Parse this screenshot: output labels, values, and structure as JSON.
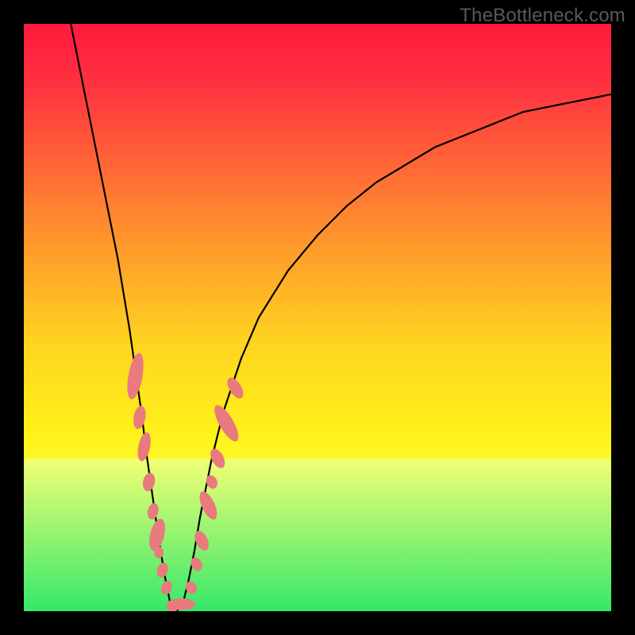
{
  "watermark": "TheBottleneck.com",
  "colors": {
    "frame": "#000000",
    "grad_stops": [
      {
        "offset": 0.0,
        "color": "#ff1a3e"
      },
      {
        "offset": 0.1,
        "color": "#ff3140"
      },
      {
        "offset": 0.25,
        "color": "#ff6a36"
      },
      {
        "offset": 0.4,
        "color": "#ffa12a"
      },
      {
        "offset": 0.55,
        "color": "#ffd61f"
      },
      {
        "offset": 0.7,
        "color": "#fff21a"
      },
      {
        "offset": 0.8,
        "color": "#f7ff3a"
      },
      {
        "offset": 0.88,
        "color": "#d2ff5c"
      },
      {
        "offset": 0.94,
        "color": "#8dff6e"
      },
      {
        "offset": 1.0,
        "color": "#34e86a"
      }
    ],
    "band_top": "#f2ff75",
    "band_bottom": "#35e86a",
    "curve": "#000000",
    "marker_fill": "#e97a7e",
    "marker_stroke": "#d86a70"
  },
  "chart_data": {
    "type": "line",
    "title": "",
    "xlabel": "",
    "ylabel": "",
    "xlim": [
      0,
      100
    ],
    "ylim": [
      0,
      100
    ],
    "note": "Axes are unlabeled; x and y are normalized 0–100 from plot extents. Curve is a V-shaped bottleneck curve with minimum near x≈25, y≈0.",
    "series": [
      {
        "name": "bottleneck-curve",
        "x": [
          8,
          10,
          12,
          14,
          16,
          18,
          20,
          21,
          22,
          23,
          24,
          25,
          26,
          27,
          28,
          29,
          30,
          32,
          34,
          37,
          40,
          45,
          50,
          55,
          60,
          65,
          70,
          75,
          80,
          85,
          90,
          95,
          100
        ],
        "y": [
          100,
          90,
          80,
          70,
          60,
          48,
          34,
          26,
          19,
          12,
          6,
          1,
          0,
          1,
          5,
          10,
          16,
          26,
          34,
          43,
          50,
          58,
          64,
          69,
          73,
          76,
          79,
          81,
          83,
          85,
          86,
          87,
          88
        ]
      }
    ],
    "markers": {
      "name": "highlight-points",
      "comment": "Pink pill/oval markers clustered on both arms near the trough",
      "points": [
        {
          "x": 19.0,
          "y": 40,
          "rx": 1.2,
          "ry": 4.0,
          "rot": 10
        },
        {
          "x": 19.7,
          "y": 33,
          "rx": 1.0,
          "ry": 2.0,
          "rot": 10
        },
        {
          "x": 20.5,
          "y": 28,
          "rx": 1.0,
          "ry": 2.5,
          "rot": 12
        },
        {
          "x": 21.3,
          "y": 22,
          "rx": 1.0,
          "ry": 1.6,
          "rot": 12
        },
        {
          "x": 22.0,
          "y": 17,
          "rx": 0.9,
          "ry": 1.4,
          "rot": 14
        },
        {
          "x": 22.7,
          "y": 13,
          "rx": 1.2,
          "ry": 2.8,
          "rot": 14
        },
        {
          "x": 23.0,
          "y": 10,
          "rx": 0.8,
          "ry": 1.0,
          "rot": 0
        },
        {
          "x": 23.6,
          "y": 7,
          "rx": 0.9,
          "ry": 1.3,
          "rot": 18
        },
        {
          "x": 24.3,
          "y": 4,
          "rx": 0.9,
          "ry": 1.2,
          "rot": 20
        },
        {
          "x": 25.3,
          "y": 0.8,
          "rx": 1.0,
          "ry": 1.0,
          "rot": 0
        },
        {
          "x": 26.8,
          "y": 1.2,
          "rx": 2.4,
          "ry": 1.0,
          "rot": 0
        },
        {
          "x": 28.5,
          "y": 4,
          "rx": 0.9,
          "ry": 1.1,
          "rot": -25
        },
        {
          "x": 29.4,
          "y": 8,
          "rx": 0.9,
          "ry": 1.2,
          "rot": -25
        },
        {
          "x": 30.3,
          "y": 12,
          "rx": 1.0,
          "ry": 1.8,
          "rot": -25
        },
        {
          "x": 31.4,
          "y": 18,
          "rx": 1.1,
          "ry": 2.6,
          "rot": -25
        },
        {
          "x": 32.0,
          "y": 22,
          "rx": 0.9,
          "ry": 1.2,
          "rot": -25
        },
        {
          "x": 33.0,
          "y": 26,
          "rx": 1.0,
          "ry": 1.8,
          "rot": -28
        },
        {
          "x": 34.5,
          "y": 32,
          "rx": 1.2,
          "ry": 3.5,
          "rot": -30
        },
        {
          "x": 36.0,
          "y": 38,
          "rx": 1.0,
          "ry": 2.0,
          "rot": -32
        }
      ]
    },
    "highlight_band": {
      "y0": 0,
      "y1": 26
    }
  }
}
